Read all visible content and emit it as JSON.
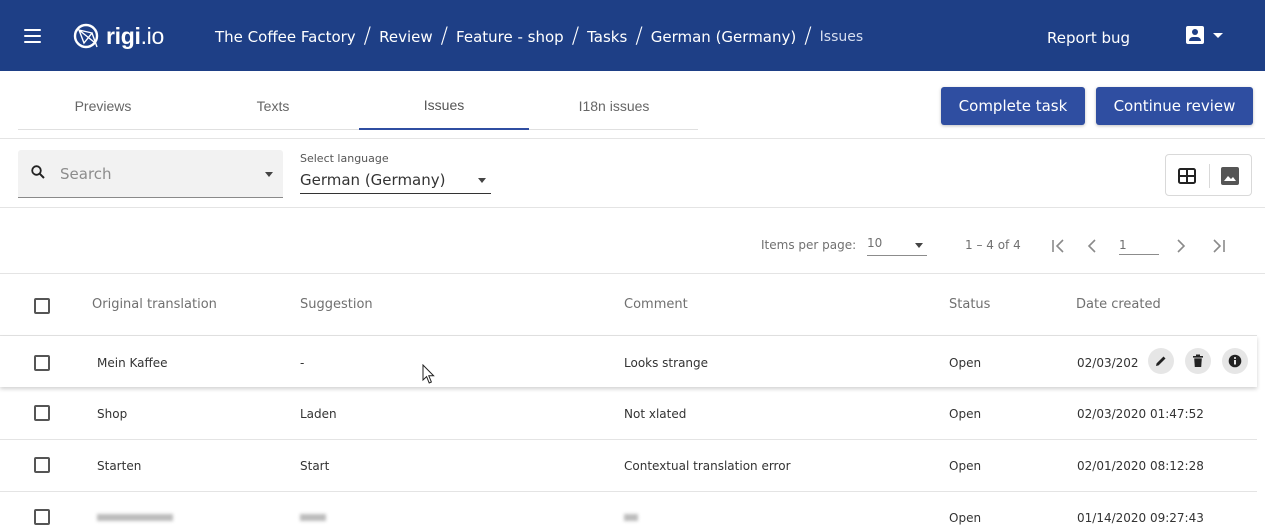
{
  "header": {
    "logo_bold": "rigi",
    "logo_light": ".io",
    "breadcrumbs": [
      "The Coffee Factory",
      "Review",
      "Feature - shop",
      "Tasks",
      "German (Germany)"
    ],
    "breadcrumb_current": "Issues",
    "report_bug_label": "Report bug"
  },
  "tabs": [
    {
      "label": "Previews",
      "active": false
    },
    {
      "label": "Texts",
      "active": false
    },
    {
      "label": "Issues",
      "active": true
    },
    {
      "label": "I18n issues",
      "active": false
    }
  ],
  "actions": {
    "complete_task_label": "Complete task",
    "continue_review_label": "Continue review"
  },
  "filters": {
    "search_placeholder": "Search",
    "language_label": "Select language",
    "language_value": "German (Germany)"
  },
  "paginator": {
    "items_per_page_label": "Items per page:",
    "items_per_page_value": "10",
    "range_label": "1 – 4 of 4",
    "page_value": "1"
  },
  "table": {
    "columns": [
      "Original translation",
      "Suggestion",
      "Comment",
      "Status",
      "Date created"
    ],
    "rows": [
      {
        "original": "Mein Kaffee",
        "suggestion": "-",
        "comment": "Looks strange",
        "status": "Open",
        "date": "02/03/202"
      },
      {
        "original": "Shop",
        "suggestion": "Laden",
        "comment": "Not xlated",
        "status": "Open",
        "date": "02/03/2020 01:47:52"
      },
      {
        "original": "Starten",
        "suggestion": "Start",
        "comment": "Contextual translation error",
        "status": "Open",
        "date": "02/01/2020 08:12:28"
      },
      {
        "original": "",
        "suggestion": "",
        "comment": "",
        "status": "Open",
        "date": "01/14/2020 09:27:43"
      }
    ]
  },
  "colors": {
    "header_bg": "#1e3f86",
    "primary_button": "#2f4ea1"
  },
  "icons": [
    "menu-icon",
    "rigi-logo-icon",
    "user-icon",
    "search-icon",
    "table-view-icon",
    "image-view-icon",
    "first-page-icon",
    "prev-page-icon",
    "next-page-icon",
    "last-page-icon",
    "edit-icon",
    "delete-icon",
    "info-icon"
  ]
}
